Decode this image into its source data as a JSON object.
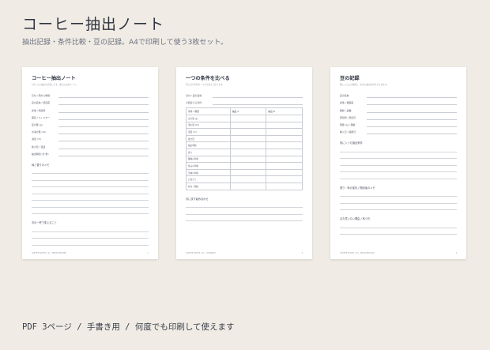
{
  "header": {
    "title": "コーヒー抽出ノート",
    "subtitle": "抽出記録・条件比較・豆の記録。A4で印刷して使う3枚セット。"
  },
  "footer": "PDF 3ページ / 手書き用 / 何度でも印刷して使えます",
  "sheets": [
    {
      "title": "コーヒー抽出ノート",
      "desc": "1杯ごとの抽出を記録します。書き込み用ページ。",
      "fields": [
        "日付 / 淹れた時間",
        "豆の名前 / 焙煎度",
        "産地 / 焙煎所",
        "器具 / フィルター",
        "豆の量 (g)",
        "お湯の量 (ml)",
        "湯温 (℃)",
        "挽き目 / 目盛",
        "抽出時間 (分:秒)"
      ],
      "sections": [
        {
          "label": "味と香りのメモ",
          "lines": 7
        },
        {
          "label": "次の一杯で変えること",
          "lines": 3
        }
      ],
      "foot_left": "COFFEE NOTES / 01 - BREW RECORD",
      "foot_right": "1"
    },
    {
      "title": "一つの条件を比べる",
      "desc": "同じ豆で条件を一つだけ変えて比べます。",
      "fields": [
        "日付 / 豆の名前",
        "今回変える条件"
      ],
      "table_head": [
        "条件 / 項目",
        "抽出 A",
        "抽出 B"
      ],
      "table_rows": [
        "豆の量 (g)",
        "湯の量 (ml)",
        "湯温 (℃)",
        "挽き目",
        "抽出時間",
        "香り",
        "酸味の印象",
        "甘みの印象",
        "苦味の印象",
        "口当たり",
        "好み / 理由"
      ],
      "sections": [
        {
          "label": "次に試す組み合わせ",
          "lines": 3
        }
      ],
      "foot_left": "COFFEE NOTES / 02 - COMPARE",
      "foot_right": "2"
    },
    {
      "title": "豆の記録",
      "desc": "購入した豆の情報と、好みの抽出条件をまとめます。",
      "fields": [
        "豆の名前",
        "産地 / 農園名",
        "精製 / 品種",
        "焙煎所 / 焙煎日",
        "容量 (g) / 価格",
        "購入日 / 開封日"
      ],
      "sections": [
        {
          "label": "気に入った抽出条件",
          "lines": 5
        },
        {
          "label": "香り・味の変化 / 開封後のメモ",
          "lines": 3
        },
        {
          "label": "また買いたい理由 / 気づき",
          "lines": 2
        }
      ],
      "foot_left": "COFFEE NOTES / 03 - BEAN RECORD",
      "foot_right": "3"
    }
  ]
}
